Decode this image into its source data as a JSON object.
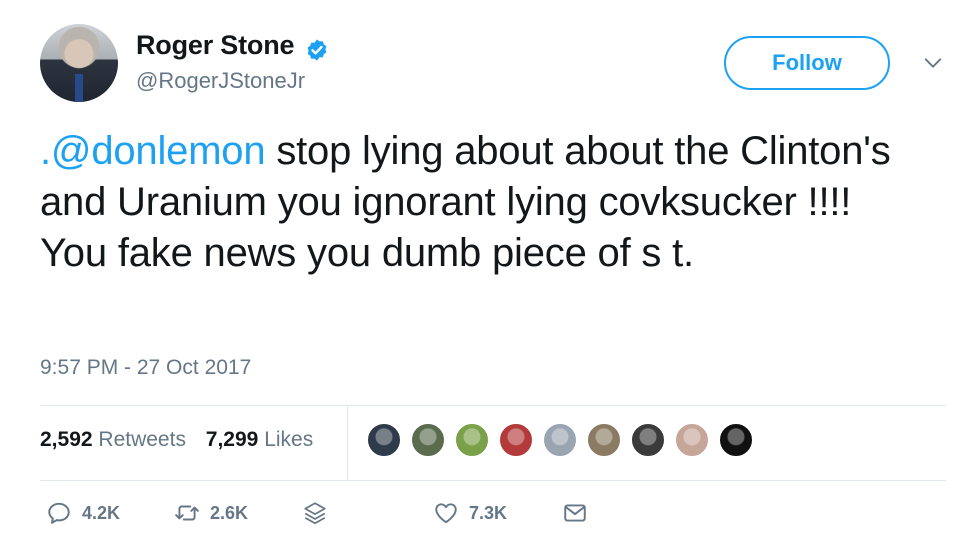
{
  "user": {
    "display_name": "Roger Stone",
    "handle": "@RogerJStoneJr",
    "verified": true
  },
  "follow_label": "Follow",
  "tweet": {
    "mention": ".@donlemon",
    "text": " stop lying about about the Clinton's and Uranium you ignorant lying covksucker !!!! You fake news you dumb piece of s   t."
  },
  "timestamp": "9:57 PM - 27 Oct 2017",
  "stats": {
    "retweets_count": "2,592",
    "retweets_label": "Retweets",
    "likes_count": "7,299",
    "likes_label": "Likes"
  },
  "likers": [
    {
      "color": "#2f3a4a"
    },
    {
      "color": "#5a6b4e"
    },
    {
      "color": "#7aa04a"
    },
    {
      "color": "#b23a3a"
    },
    {
      "color": "#9aa5b1"
    },
    {
      "color": "#8a7b62"
    },
    {
      "color": "#3b3b3b"
    },
    {
      "color": "#c7a69a"
    },
    {
      "color": "#111111"
    }
  ],
  "actions": {
    "reply_count": "4.2K",
    "retweet_count": "2.6K",
    "like_count": "7.3K"
  },
  "colors": {
    "accent": "#1da1f2",
    "muted": "#657786",
    "text": "#14171a"
  }
}
